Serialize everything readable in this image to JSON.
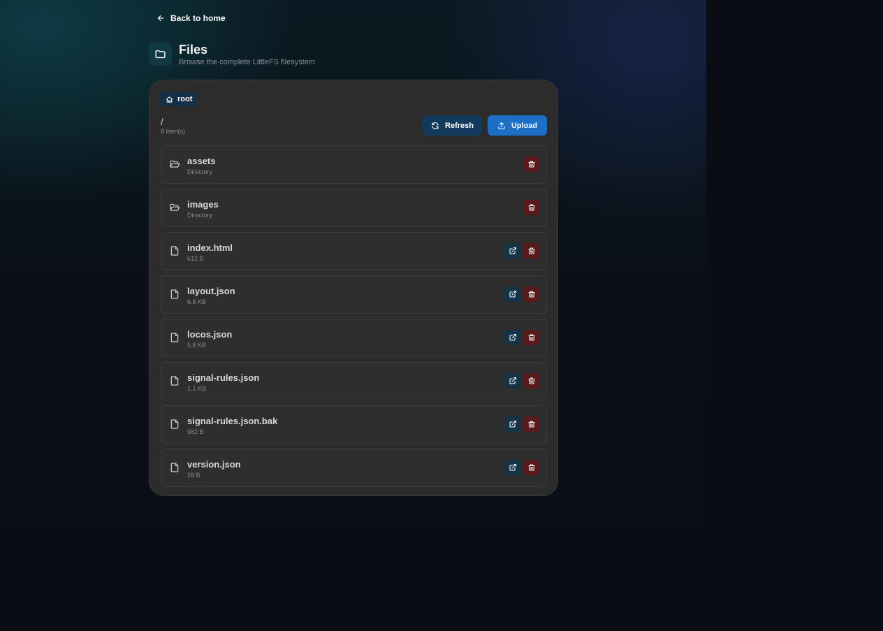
{
  "nav": {
    "back_label": "Back to home"
  },
  "header": {
    "title": "Files",
    "subtitle": "Browse the complete LittleFS filesystem",
    "icon": "folder-icon"
  },
  "breadcrumb": {
    "label": "root",
    "icon": "home-icon"
  },
  "path": {
    "current": "/",
    "count": "8 item(s)"
  },
  "toolbar": {
    "refresh_label": "Refresh",
    "upload_label": "Upload"
  },
  "colors": {
    "card_bg": "#2c2c2c",
    "primary": "#1c6fc4",
    "secondary": "#123a5c",
    "danger": "#5a1a1a"
  },
  "files": [
    {
      "name": "assets",
      "meta": "Directory",
      "type": "directory"
    },
    {
      "name": "images",
      "meta": "Directory",
      "type": "directory"
    },
    {
      "name": "index.html",
      "meta": "612 B",
      "type": "file"
    },
    {
      "name": "layout.json",
      "meta": "6.8 KB",
      "type": "file"
    },
    {
      "name": "locos.json",
      "meta": "5.8 KB",
      "type": "file"
    },
    {
      "name": "signal-rules.json",
      "meta": "1.1 KB",
      "type": "file"
    },
    {
      "name": "signal-rules.json.bak",
      "meta": "982 B",
      "type": "file"
    },
    {
      "name": "version.json",
      "meta": "28 B",
      "type": "file"
    }
  ]
}
